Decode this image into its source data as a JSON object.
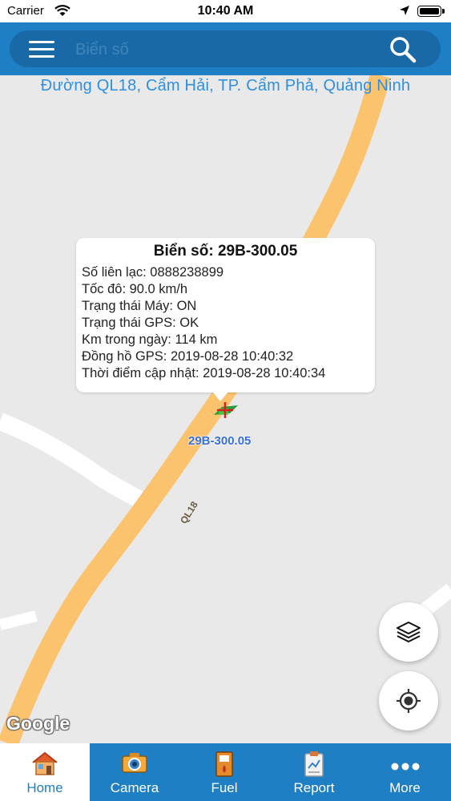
{
  "status_bar": {
    "carrier": "Carrier",
    "time": "10:40 AM"
  },
  "search": {
    "placeholder": "Biển số"
  },
  "map": {
    "address": "Đường QL18, Cẩm Hải, TP. Cẩm Phả, Quảng Ninh",
    "road_label": "QL18",
    "vehicle_label": "29B-300.05",
    "attribution": "Google"
  },
  "popup": {
    "title": "Biển số: 29B-300.05",
    "lines": [
      "Số liên lạc: 0888238899",
      "Tốc đô: 90.0 km/h",
      "Trạng thái Máy: ON",
      "Trạng thái GPS: OK",
      "Km trong ngày: 114 km",
      "Đồng hồ GPS: 2019-08-28 10:40:32",
      "Thời điểm cập nhật: 2019-08-28 10:40:34"
    ]
  },
  "tabs": [
    {
      "label": "Home",
      "icon": "home-icon",
      "active": true
    },
    {
      "label": "Camera",
      "icon": "camera-icon",
      "active": false
    },
    {
      "label": "Fuel",
      "icon": "fuel-icon",
      "active": false
    },
    {
      "label": "Report",
      "icon": "report-icon",
      "active": false
    },
    {
      "label": "More",
      "icon": "more-icon",
      "active": false
    }
  ],
  "colors": {
    "primary": "#1f7fc4",
    "road": "#fcc36f",
    "map_bg": "#e9e9e9",
    "address_text": "#2f8fe0",
    "vehicle_label": "#3a6fd8"
  }
}
